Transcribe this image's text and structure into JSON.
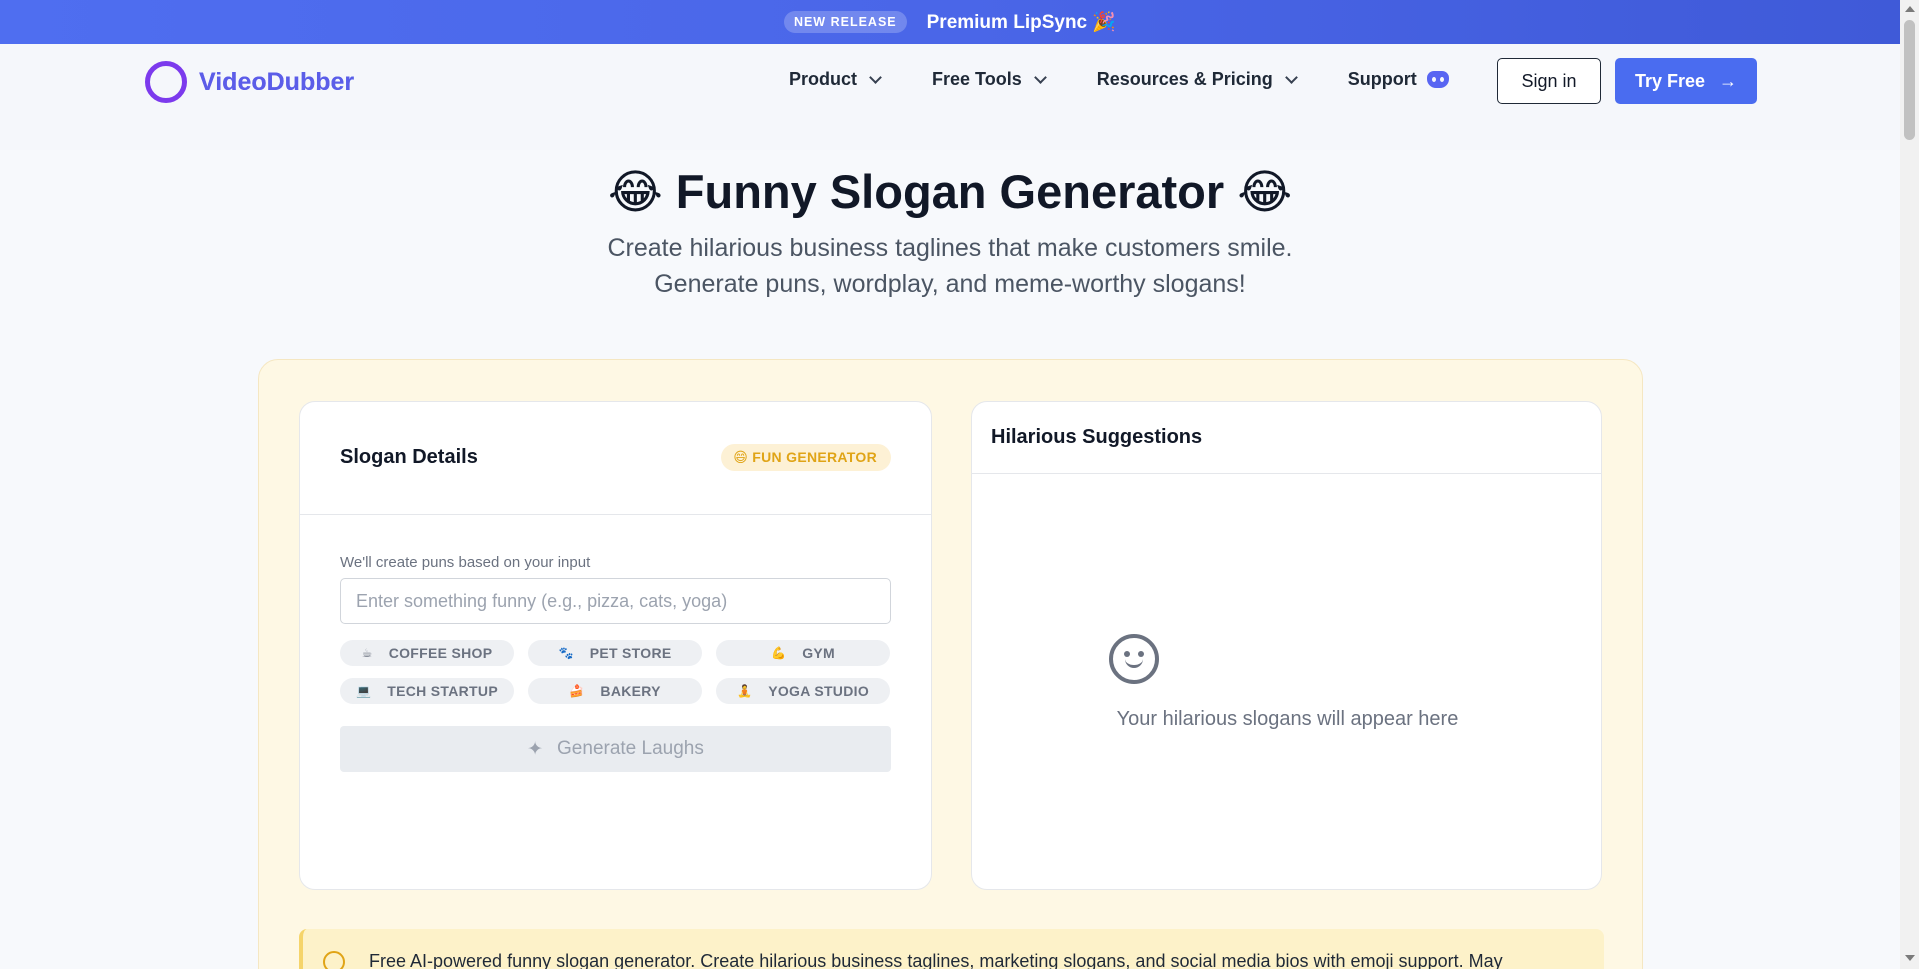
{
  "announcement": {
    "badge": "NEW RELEASE",
    "message": "Premium LipSync 🎉"
  },
  "header": {
    "logo_text": "VideoDubber",
    "nav": [
      {
        "label": "Product"
      },
      {
        "label": "Free Tools"
      },
      {
        "label": "Resources & Pricing"
      },
      {
        "label": "Support"
      }
    ],
    "sign_in": "Sign in",
    "try_free": "Try Free",
    "try_free_arrow": "→"
  },
  "hero": {
    "title": "😂 Funny Slogan Generator 😂",
    "subtitle_line1": "Create hilarious business taglines that make customers smile.",
    "subtitle_line2": "Generate puns, wordplay, and meme-worthy slogans!"
  },
  "form": {
    "title": "Slogan Details",
    "badge": "😄 FUN GENERATOR",
    "label": "We'll create puns based on your input",
    "placeholder": "Enter something funny (e.g., pizza, cats, yoga)",
    "chips": [
      {
        "icon": "☕",
        "label": "COFFEE SHOP"
      },
      {
        "icon": "🐾",
        "label": "PET STORE"
      },
      {
        "icon": "💪",
        "label": "GYM"
      },
      {
        "icon": "💻",
        "label": "TECH STARTUP"
      },
      {
        "icon": "🍰",
        "label": "BAKERY"
      },
      {
        "icon": "🧘",
        "label": "YOGA STUDIO"
      }
    ],
    "generate_icon": "✦",
    "generate_label": "Generate Laughs"
  },
  "results": {
    "title": "Hilarious Suggestions",
    "empty_text": "Your hilarious slogans will appear here"
  },
  "info": {
    "text": "Free AI-powered funny slogan generator. Create hilarious business taglines, marketing slogans, and social media bios with emoji support. May"
  },
  "colors": {
    "accent": "#4a6cf0",
    "panel_bg": "#fef8e4",
    "badge_text": "#e0a416"
  }
}
